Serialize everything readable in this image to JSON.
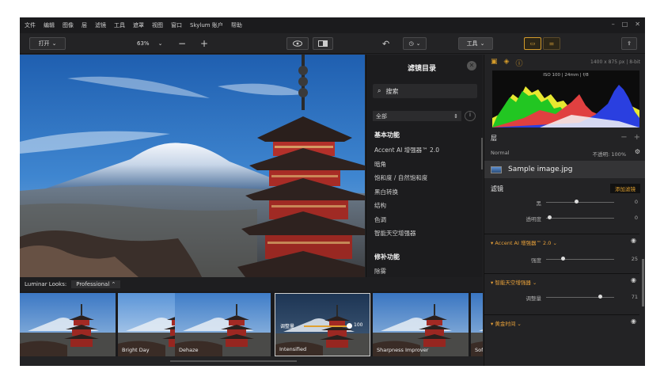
{
  "menu": [
    "文件",
    "编辑",
    "图像",
    "层",
    "滤镜",
    "工具",
    "遮罩",
    "视图",
    "窗口",
    "Skylum 账户",
    "帮助"
  ],
  "window_controls": [
    "–",
    "□",
    "✕"
  ],
  "toolbar": {
    "open_label": "打开",
    "zoom_value": "63%",
    "minus": "−",
    "plus": "+",
    "tools_label": "工具"
  },
  "catalog": {
    "title": "滤镜目录",
    "search_placeholder": "搜索",
    "filter_select": "全部",
    "section_basic": "基本功能",
    "basic_items": [
      "Accent AI 增强器™ 2.0",
      "暗角",
      "饱和度 / 自然饱和度",
      "黑白转换",
      "结构",
      "色调",
      "智能天空增强器"
    ],
    "section_repair": "修补功能",
    "repair_items": [
      "除雾"
    ]
  },
  "right_panel": {
    "image_info": "1400 x 875 px | 8-bit",
    "camera_info": "ISO 100 | 24mm | f/8",
    "layers_title": "层",
    "blend_mode": "Normal",
    "opacity_label": "不透明: 100%",
    "layer_name": "Sample image.jpg",
    "filters_title": "滤镜",
    "add_filter": "添加滤镜",
    "sliders": [
      {
        "label": "黑",
        "value": "0",
        "pos": 0.45
      },
      {
        "label": "透明度",
        "value": "0",
        "pos": 0.05
      },
      {
        "label": "强度",
        "value": "25",
        "pos": 0.25
      },
      {
        "label": "调整量",
        "value": "71",
        "pos": 0.8
      }
    ],
    "sections": [
      "Accent AI 增强器™ 2.0",
      "智能天空增强器",
      "黄金时间"
    ]
  },
  "looks": {
    "label": "Luminar Looks:",
    "category": "Professional",
    "thumbs": [
      "",
      "Bright Day",
      "Dehaze",
      "Intensified",
      "Sharpness Improver",
      "Sof"
    ],
    "selected_amount_label": "调整量",
    "selected_amount": "100"
  }
}
